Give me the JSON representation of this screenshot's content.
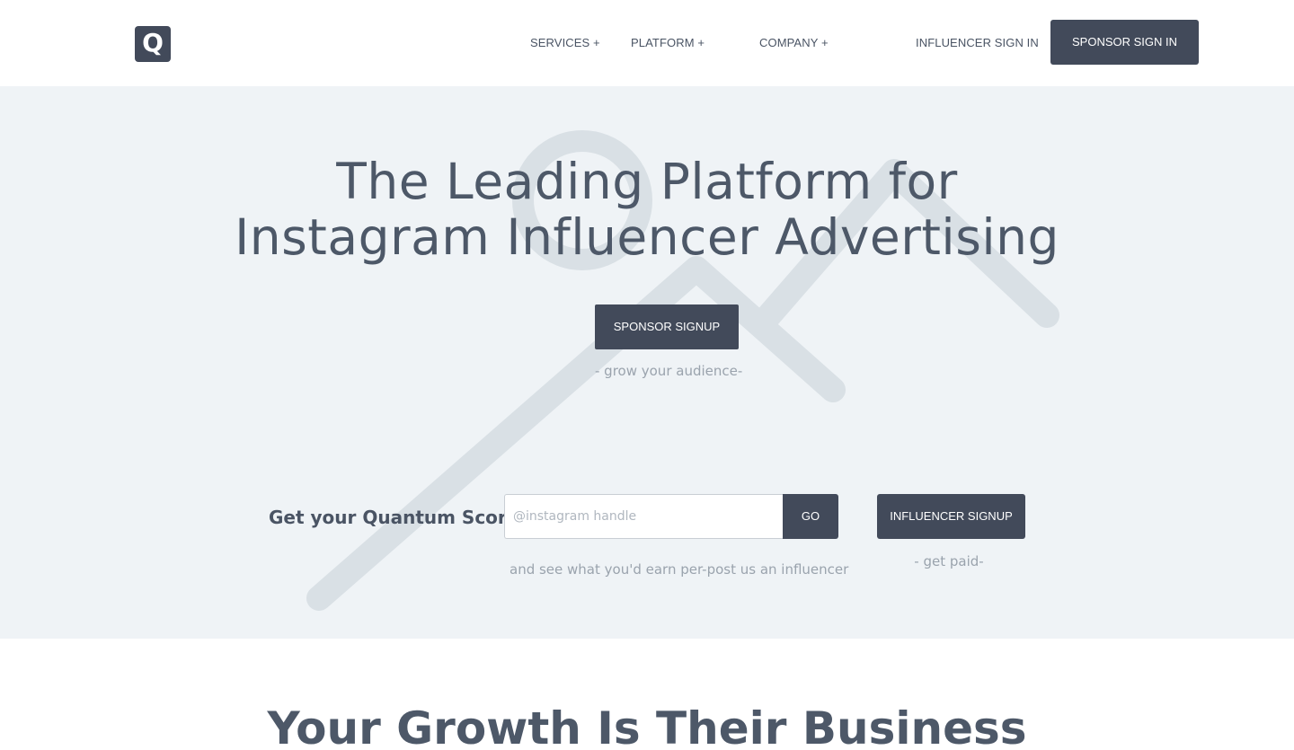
{
  "header": {
    "logo_letter": "Q",
    "nav": {
      "services": "SERVICES +",
      "platform": "PLATFORM +",
      "company": "COMPANY +",
      "influencer_sign_in": "INFLUENCER SIGN IN",
      "sponsor_sign_in": "SPONSOR SIGN IN"
    }
  },
  "hero": {
    "title_line1": "The Leading Platform for",
    "title_line2": "Instagram Influencer Advertising",
    "sponsor_signup_label": "SPONSOR SIGNUP",
    "sponsor_tagline": "- grow your audience-",
    "score_label": "Get your Quantum Score",
    "handle_placeholder": "@instagram handle",
    "handle_value": "",
    "go_label": "GO",
    "score_subtext": "and see what you'd earn per-post us an influencer",
    "influencer_signup_label": "INFLUENCER SIGNUP",
    "influencer_tagline": "- get paid-"
  },
  "section2": {
    "title": "Your Growth Is Their Business"
  },
  "colors": {
    "button_bg": "#424a5a",
    "hero_bg": "#eff3f6",
    "heading_text": "#4d5868",
    "muted_text": "#9aa3ad",
    "bg_graphic": "#d9e0e5"
  }
}
